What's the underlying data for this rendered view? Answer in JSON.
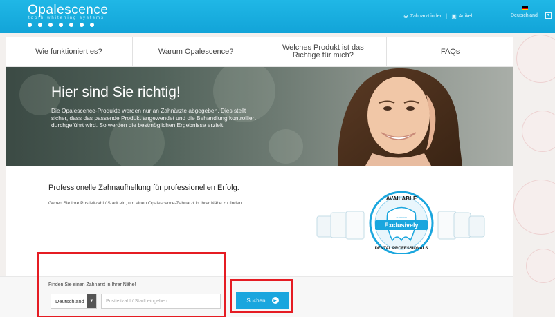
{
  "header": {
    "logo": "Opalescence",
    "logo_sub": "tooth whitening systems",
    "links": [
      {
        "label": "Zahnarztfinder",
        "icon": "globe-icon"
      },
      {
        "label": "Artikel",
        "icon": "article-icon"
      }
    ],
    "separator": "|",
    "country": "Deutschland"
  },
  "nav": {
    "items": [
      {
        "label": "Wie funktioniert es?"
      },
      {
        "label": "Warum Opalescence?"
      },
      {
        "label": "Welches Produkt ist das Richtige für mich?"
      },
      {
        "label": "FAQs"
      }
    ]
  },
  "hero": {
    "title": "Hier sind Sie richtig!",
    "text": "Die Opalescence-Produkte werden nur an Zahnärzte abgegeben. Dies stellt sicher, dass das passende Produkt angewendet und die Behandlung kontrolliert durchgeführt wird. So werden die bestmöglichen Ergebnisse erzielt."
  },
  "content": {
    "title": "Professionelle Zahnaufhellung für professionellen Erfolg.",
    "text": "Geben Sie Ihre Postleitzahl / Stadt ein, um einen Opalescence-Zahnarzt in Ihrer Nähe zu finden.",
    "badge": {
      "top": "AVAILABLE",
      "middle": "Exclusively",
      "small": "THROUGH",
      "bottom": "DENTAL PROFESSIONALS"
    }
  },
  "search": {
    "label": "Finden Sie einen Zahnarzt in Ihrer Nähe!",
    "country_value": "Deutschland",
    "placeholder": "Postleitzahl / Stadt eingeben",
    "button": "Suchen"
  },
  "colors": {
    "brand": "#1aa6de",
    "annotation": "#e51c23"
  }
}
